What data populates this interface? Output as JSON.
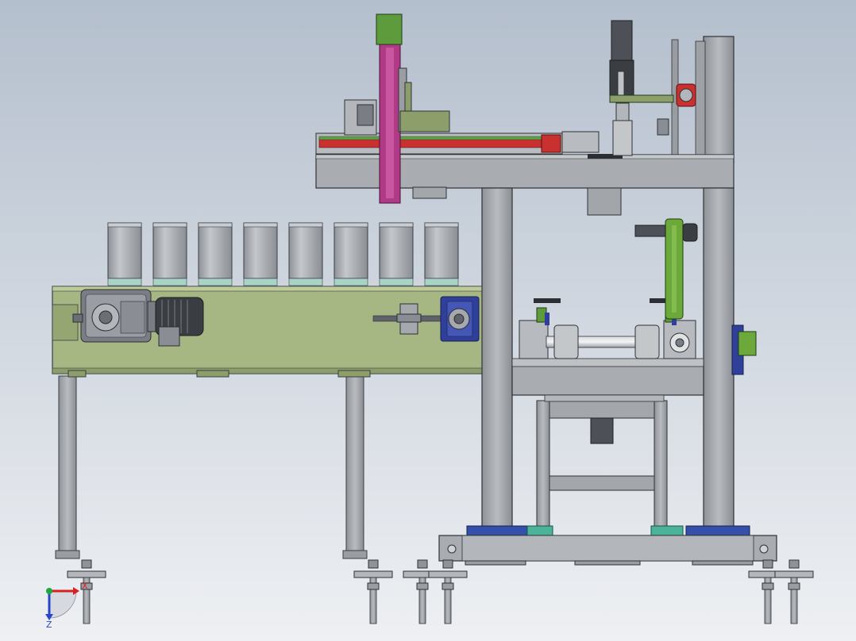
{
  "viewport": {
    "background_top": "#b4bfcd",
    "background_bottom": "#eef0f3"
  },
  "triad": {
    "x_label": "X",
    "z_label": "Z",
    "x_color": "#d92020",
    "z_color": "#2a46c8",
    "y_color": "#1fa83a"
  },
  "colors": {
    "frame": "#a4a7ab",
    "frame_dark": "#7c8086",
    "conveyor_body": "#a7b784",
    "conveyor_dark": "#8d9e6b",
    "cup": "#a2a6ab",
    "cup_base": "#a8d4c8",
    "gantry_rail_red": "#c93030",
    "gantry_rail_green": "#5fa04a",
    "vertical_axis_magenta": "#b03a86",
    "motor_green": "#5e9b3c",
    "lever_green": "#6ca83a",
    "bearing_blue": "#2f3f9a",
    "base_plate_blue": "#3550a8",
    "base_plate_teal": "#4ab39a",
    "gearbox_dark": "#6c7077",
    "motor_body": "#3a3d42"
  },
  "components": {
    "cup_count": 8,
    "leveling_feet": 6
  }
}
